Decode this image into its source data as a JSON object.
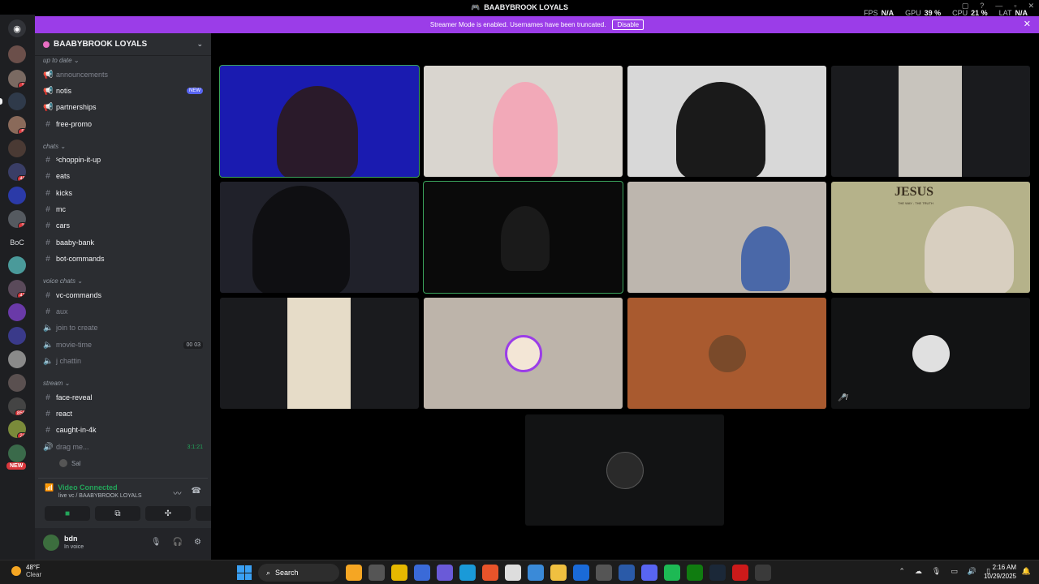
{
  "window": {
    "title": "BAABYBROOK LOYALS"
  },
  "perf": {
    "fps_label": "FPS",
    "fps": "N/A",
    "gpu_label": "GPU",
    "gpu": "39 %",
    "cpu_label": "CPU",
    "cpu": "21 %",
    "lat_label": "LAT",
    "lat": "N/A"
  },
  "banner": {
    "text": "Streamer Mode is enabled. Usernames have been truncated.",
    "disable": "Disable"
  },
  "rail": {
    "badges": [
      "1",
      "5",
      "40",
      "2",
      "43",
      "859",
      "24"
    ],
    "boc": "BoC",
    "new": "NEW"
  },
  "server": {
    "name": "BAABYBROOK LOYALS"
  },
  "categories": {
    "uptodate": "up to date",
    "chats": "chats",
    "voice": "voice chats",
    "stream": "stream"
  },
  "channels": {
    "announcements": "announcements",
    "notis": "notis",
    "notis_tag": "NEW",
    "partnerships": "partnerships",
    "freepromo": "free-promo",
    "choppin": "ˢchoppin-it-up",
    "eats": "eats",
    "kicks": "kicks",
    "mc": "mc",
    "cars": "cars",
    "bank": "baaby-bank",
    "botcmd": "bot-commands",
    "vccmd": "vc-commands",
    "aux": "aux",
    "join": "join to create",
    "movie": "movie-time",
    "movie_count": "00 03",
    "jchattin": "j chattin",
    "facereveal": "face-reveal",
    "react": "react",
    "caught": "caught-in-4k",
    "drag": "drag me...",
    "drag_timer": "3:1:21",
    "sub_user": "Sal"
  },
  "voice": {
    "status": "Video Connected",
    "sub": "live vc / BAABYBROOK LOYALS"
  },
  "user": {
    "name": "bdn",
    "status": "In voice"
  },
  "taskbar": {
    "temp": "48°F",
    "cond": "Clear",
    "search": "Search",
    "time": "2:16 AM",
    "date": "10/29/2025"
  },
  "tiles": {
    "jesus_text": "JESUS",
    "jesus_sub": "THE WAY - THE TRUTH"
  }
}
